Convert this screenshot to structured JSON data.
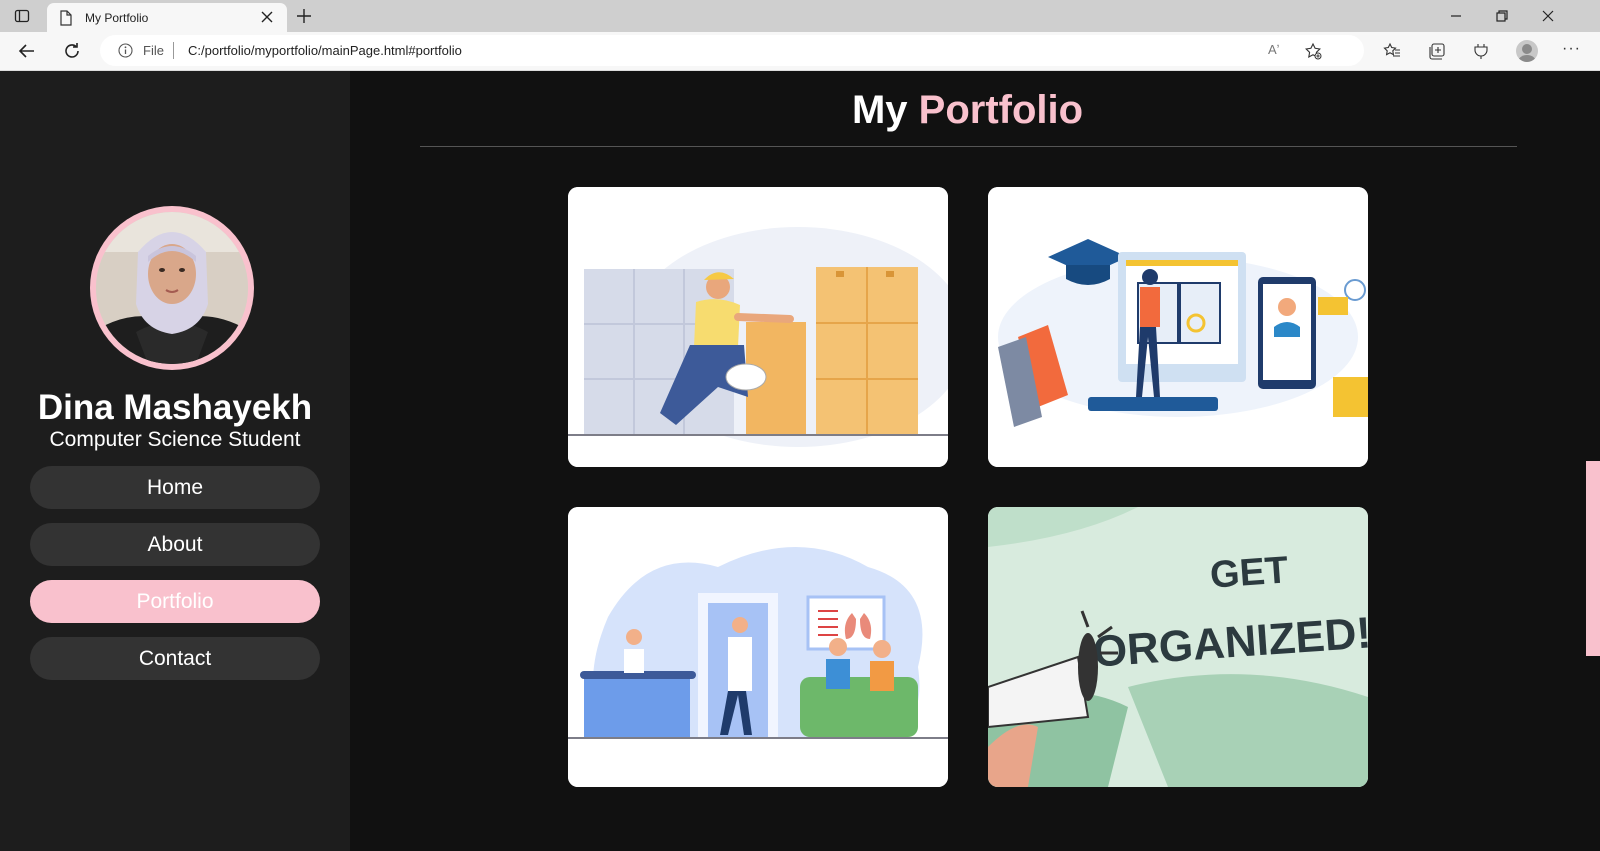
{
  "browser": {
    "tab_title": "My Portfolio",
    "address_prefix": "File",
    "url": "C:/portfolio/myportfolio/mainPage.html#portfolio",
    "read_aloud": "Aʼ"
  },
  "sidebar": {
    "name": "Dina Mashayekh",
    "role": "Computer Science Student",
    "nav": [
      {
        "label": "Home",
        "active": false
      },
      {
        "label": "About",
        "active": false
      },
      {
        "label": "Portfolio",
        "active": true
      },
      {
        "label": "Contact",
        "active": false
      }
    ]
  },
  "main": {
    "title_first": "My",
    "title_accent": "Portfolio",
    "cards": [
      {
        "caption": ""
      },
      {
        "caption": ""
      },
      {
        "caption": ""
      },
      {
        "caption_line1": "GET",
        "caption_line2": "ORGANIZED!"
      }
    ]
  },
  "colors": {
    "accent_pink": "#f9c1cd",
    "sidebar_bg": "#1d1d1d",
    "main_bg": "#111111",
    "nav_bg": "#333333"
  }
}
